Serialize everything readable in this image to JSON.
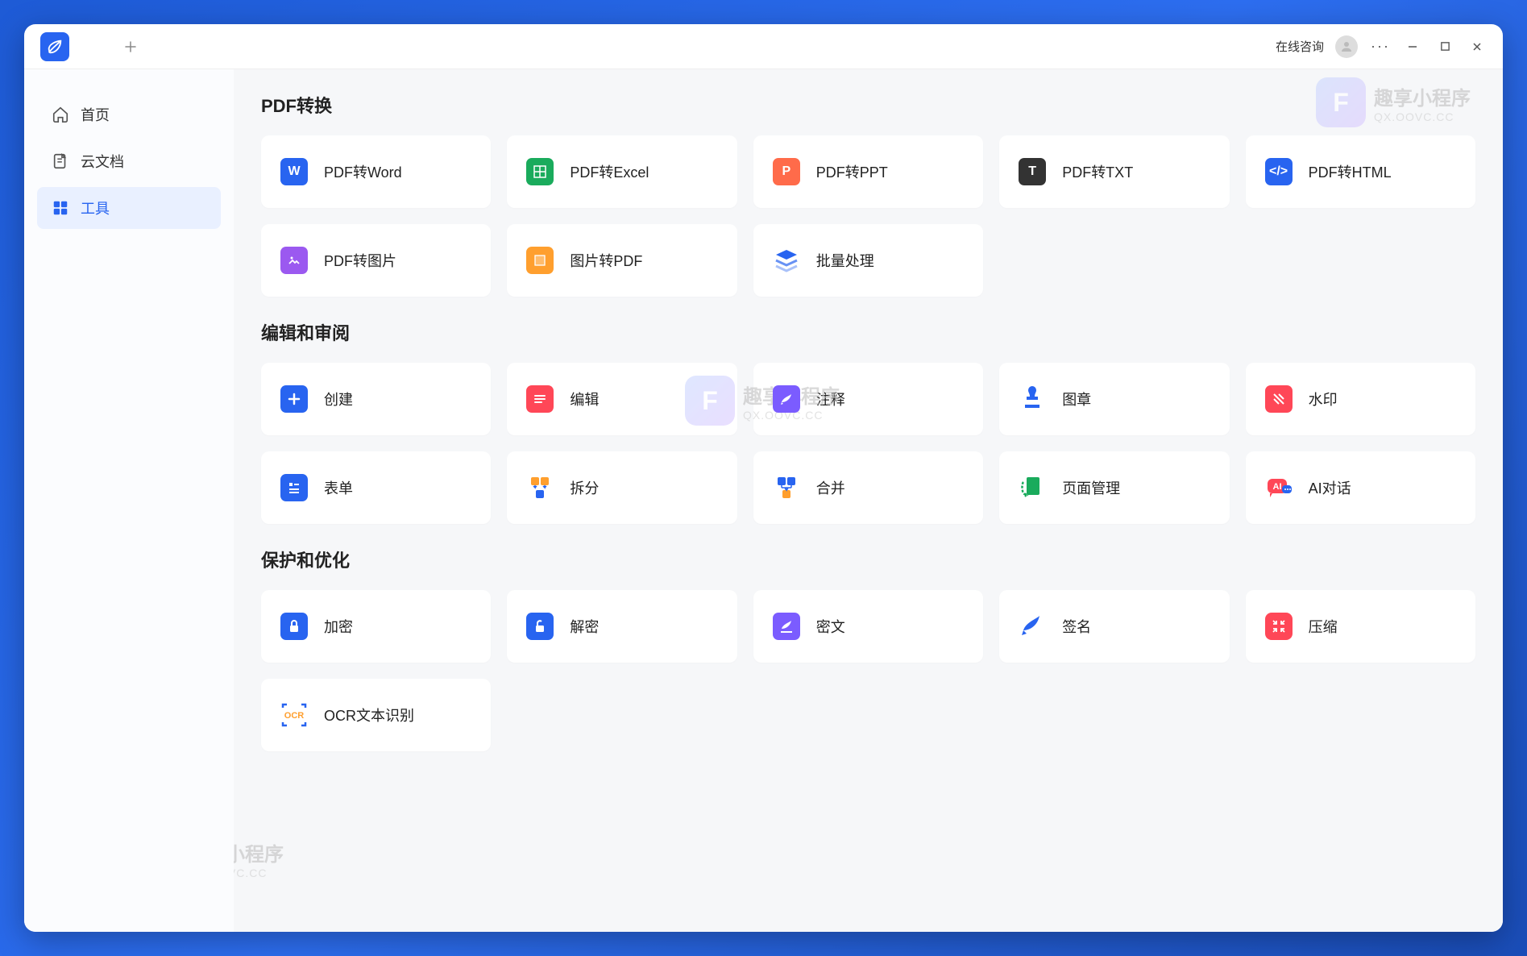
{
  "titlebar": {
    "online_consult": "在线咨询",
    "more": "···"
  },
  "sidebar": {
    "items": [
      {
        "id": "home",
        "label": "首页",
        "icon": "home-icon"
      },
      {
        "id": "cloud",
        "label": "云文档",
        "icon": "cloud-doc-icon"
      },
      {
        "id": "tools",
        "label": "工具",
        "icon": "grid-icon"
      }
    ],
    "active": "tools"
  },
  "sections": [
    {
      "title": "PDF转换",
      "tools": [
        {
          "id": "pdf2word",
          "label": "PDF转Word",
          "icon": "word-icon"
        },
        {
          "id": "pdf2excel",
          "label": "PDF转Excel",
          "icon": "excel-icon"
        },
        {
          "id": "pdf2ppt",
          "label": "PDF转PPT",
          "icon": "ppt-icon"
        },
        {
          "id": "pdf2txt",
          "label": "PDF转TXT",
          "icon": "txt-icon"
        },
        {
          "id": "pdf2html",
          "label": "PDF转HTML",
          "icon": "html-icon"
        },
        {
          "id": "pdf2img",
          "label": "PDF转图片",
          "icon": "image-icon"
        },
        {
          "id": "img2pdf",
          "label": "图片转PDF",
          "icon": "img2pdf-icon"
        },
        {
          "id": "batch",
          "label": "批量处理",
          "icon": "batch-icon"
        }
      ]
    },
    {
      "title": "编辑和审阅",
      "tools": [
        {
          "id": "create",
          "label": "创建",
          "icon": "plus-icon"
        },
        {
          "id": "edit",
          "label": "编辑",
          "icon": "edit-icon"
        },
        {
          "id": "annotate",
          "label": "注释",
          "icon": "annotate-icon"
        },
        {
          "id": "stamp",
          "label": "图章",
          "icon": "stamp-icon"
        },
        {
          "id": "watermark",
          "label": "水印",
          "icon": "watermark-icon"
        },
        {
          "id": "form",
          "label": "表单",
          "icon": "form-icon"
        },
        {
          "id": "split",
          "label": "拆分",
          "icon": "split-icon"
        },
        {
          "id": "merge",
          "label": "合并",
          "icon": "merge-icon"
        },
        {
          "id": "pages",
          "label": "页面管理",
          "icon": "pages-icon"
        },
        {
          "id": "aichat",
          "label": "AI对话",
          "icon": "ai-icon"
        }
      ]
    },
    {
      "title": "保护和优化",
      "tools": [
        {
          "id": "encrypt",
          "label": "加密",
          "icon": "lock-icon"
        },
        {
          "id": "decrypt",
          "label": "解密",
          "icon": "unlock-icon"
        },
        {
          "id": "redact",
          "label": "密文",
          "icon": "redact-icon"
        },
        {
          "id": "sign",
          "label": "签名",
          "icon": "sign-icon"
        },
        {
          "id": "compress",
          "label": "压缩",
          "icon": "compress-icon"
        },
        {
          "id": "ocr",
          "label": "OCR文本识别",
          "icon": "ocr-icon"
        }
      ]
    }
  ],
  "watermark": {
    "letter": "F",
    "line1": "趣享小程序",
    "line2": "QX.OOVC.CC"
  }
}
